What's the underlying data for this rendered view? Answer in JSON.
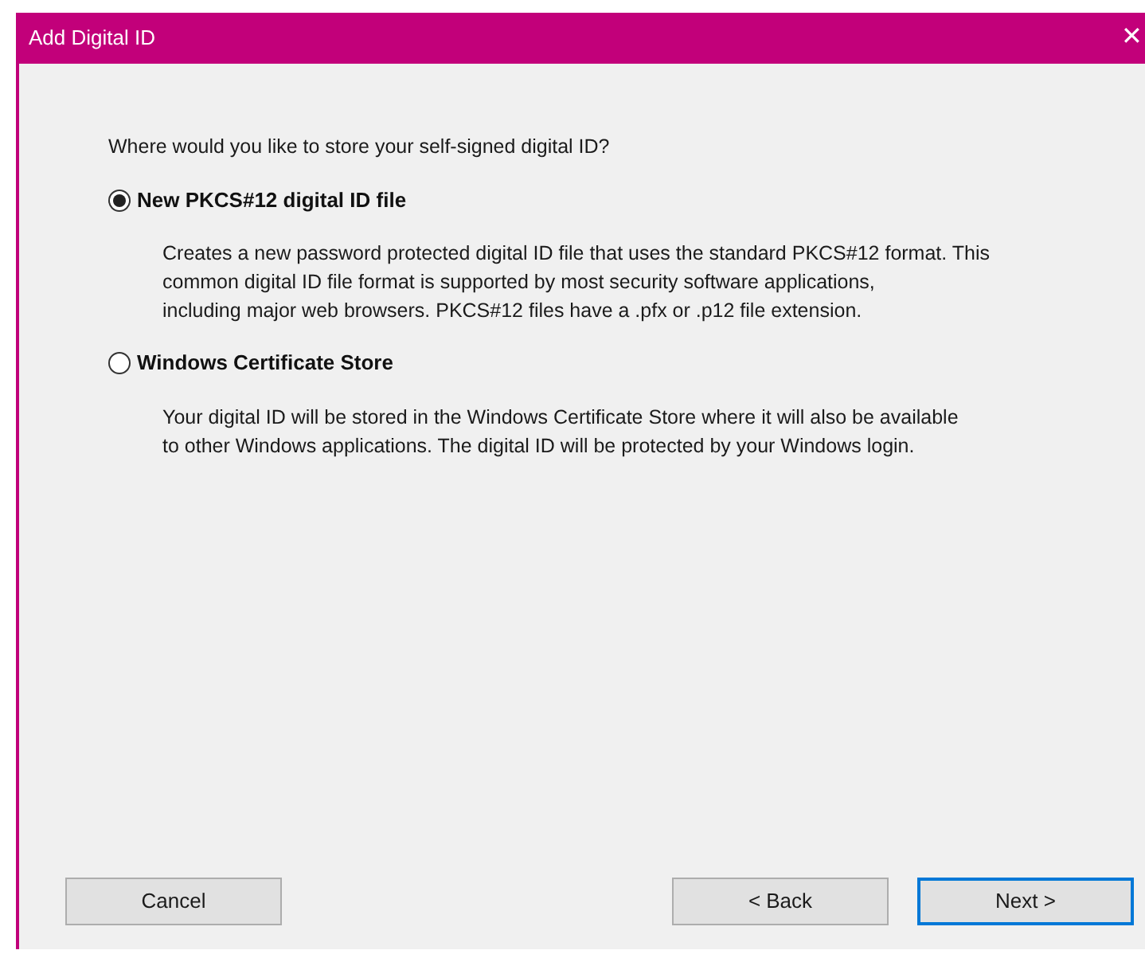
{
  "window": {
    "title": "Add Digital ID",
    "close": "✕"
  },
  "question": "Where would you like to store your self-signed digital ID?",
  "options": [
    {
      "label": "New PKCS#12 digital ID file",
      "selected": true,
      "description": [
        "Creates a new password protected digital ID file that uses the standard PKCS#12 format. This",
        "common digital ID file format is supported by most security software applications,",
        "including major web browsers. PKCS#12 files have a .pfx or .p12 file extension."
      ]
    },
    {
      "label": "Windows Certificate Store",
      "selected": false,
      "description": [
        "Your digital ID will be stored in the Windows Certificate Store where it will also be available",
        "to other Windows applications. The digital ID will be protected by your Windows login."
      ]
    }
  ],
  "buttons": [
    {
      "label": "Cancel",
      "default": false
    },
    {
      "label": "< Back",
      "default": false
    },
    {
      "label": "Next >",
      "default": true
    }
  ]
}
